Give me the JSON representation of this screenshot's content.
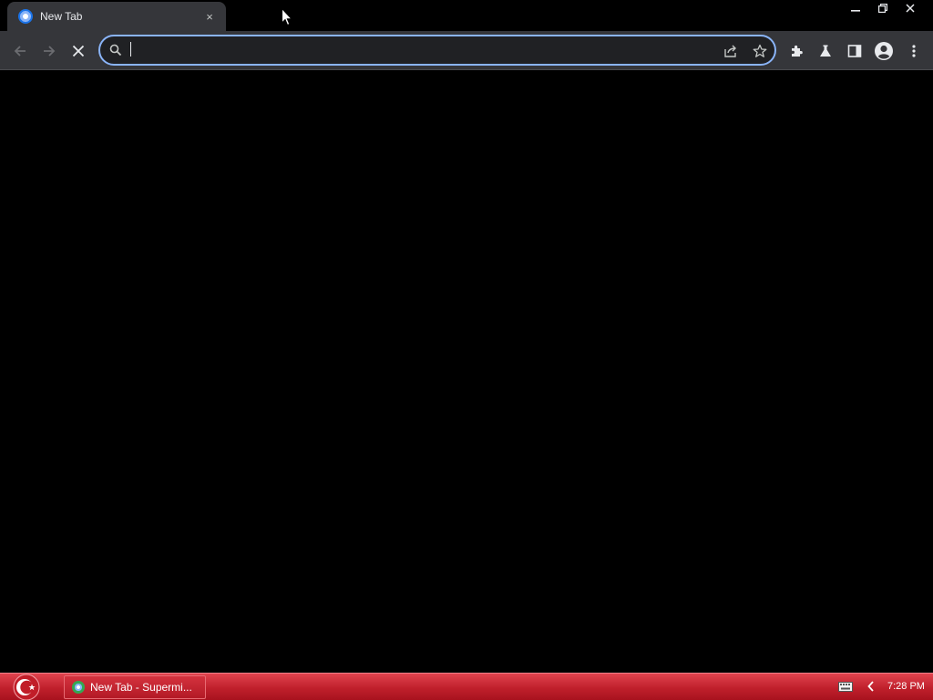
{
  "browser": {
    "tab": {
      "title": "New Tab",
      "favicon": "chromium-icon",
      "close": "×"
    },
    "window_controls": [
      "minimize-icon",
      "restore-icon",
      "close-icon"
    ],
    "toolbar": {
      "back": "back-arrow-icon",
      "forward": "forward-arrow-icon",
      "stop": "stop-loading-icon",
      "omnibox": {
        "value": "",
        "placeholder": ""
      },
      "omnibox_actions": [
        "share-icon",
        "bookmark-star-icon"
      ],
      "extensions": [
        "extensions-puzzle-icon",
        "labs-flask-icon",
        "side-panel-icon",
        "profile-avatar-icon",
        "more-menu-icon"
      ]
    },
    "accent_color": "#8ab4f8"
  },
  "taskbar": {
    "start_icon": "start-crescent-icon",
    "task": {
      "label": "New Tab - Supermi..."
    },
    "tray": [
      "keyboard-icon",
      "tray-chevron-icon"
    ],
    "clock": "7:28 PM",
    "color": "#c0202c"
  }
}
